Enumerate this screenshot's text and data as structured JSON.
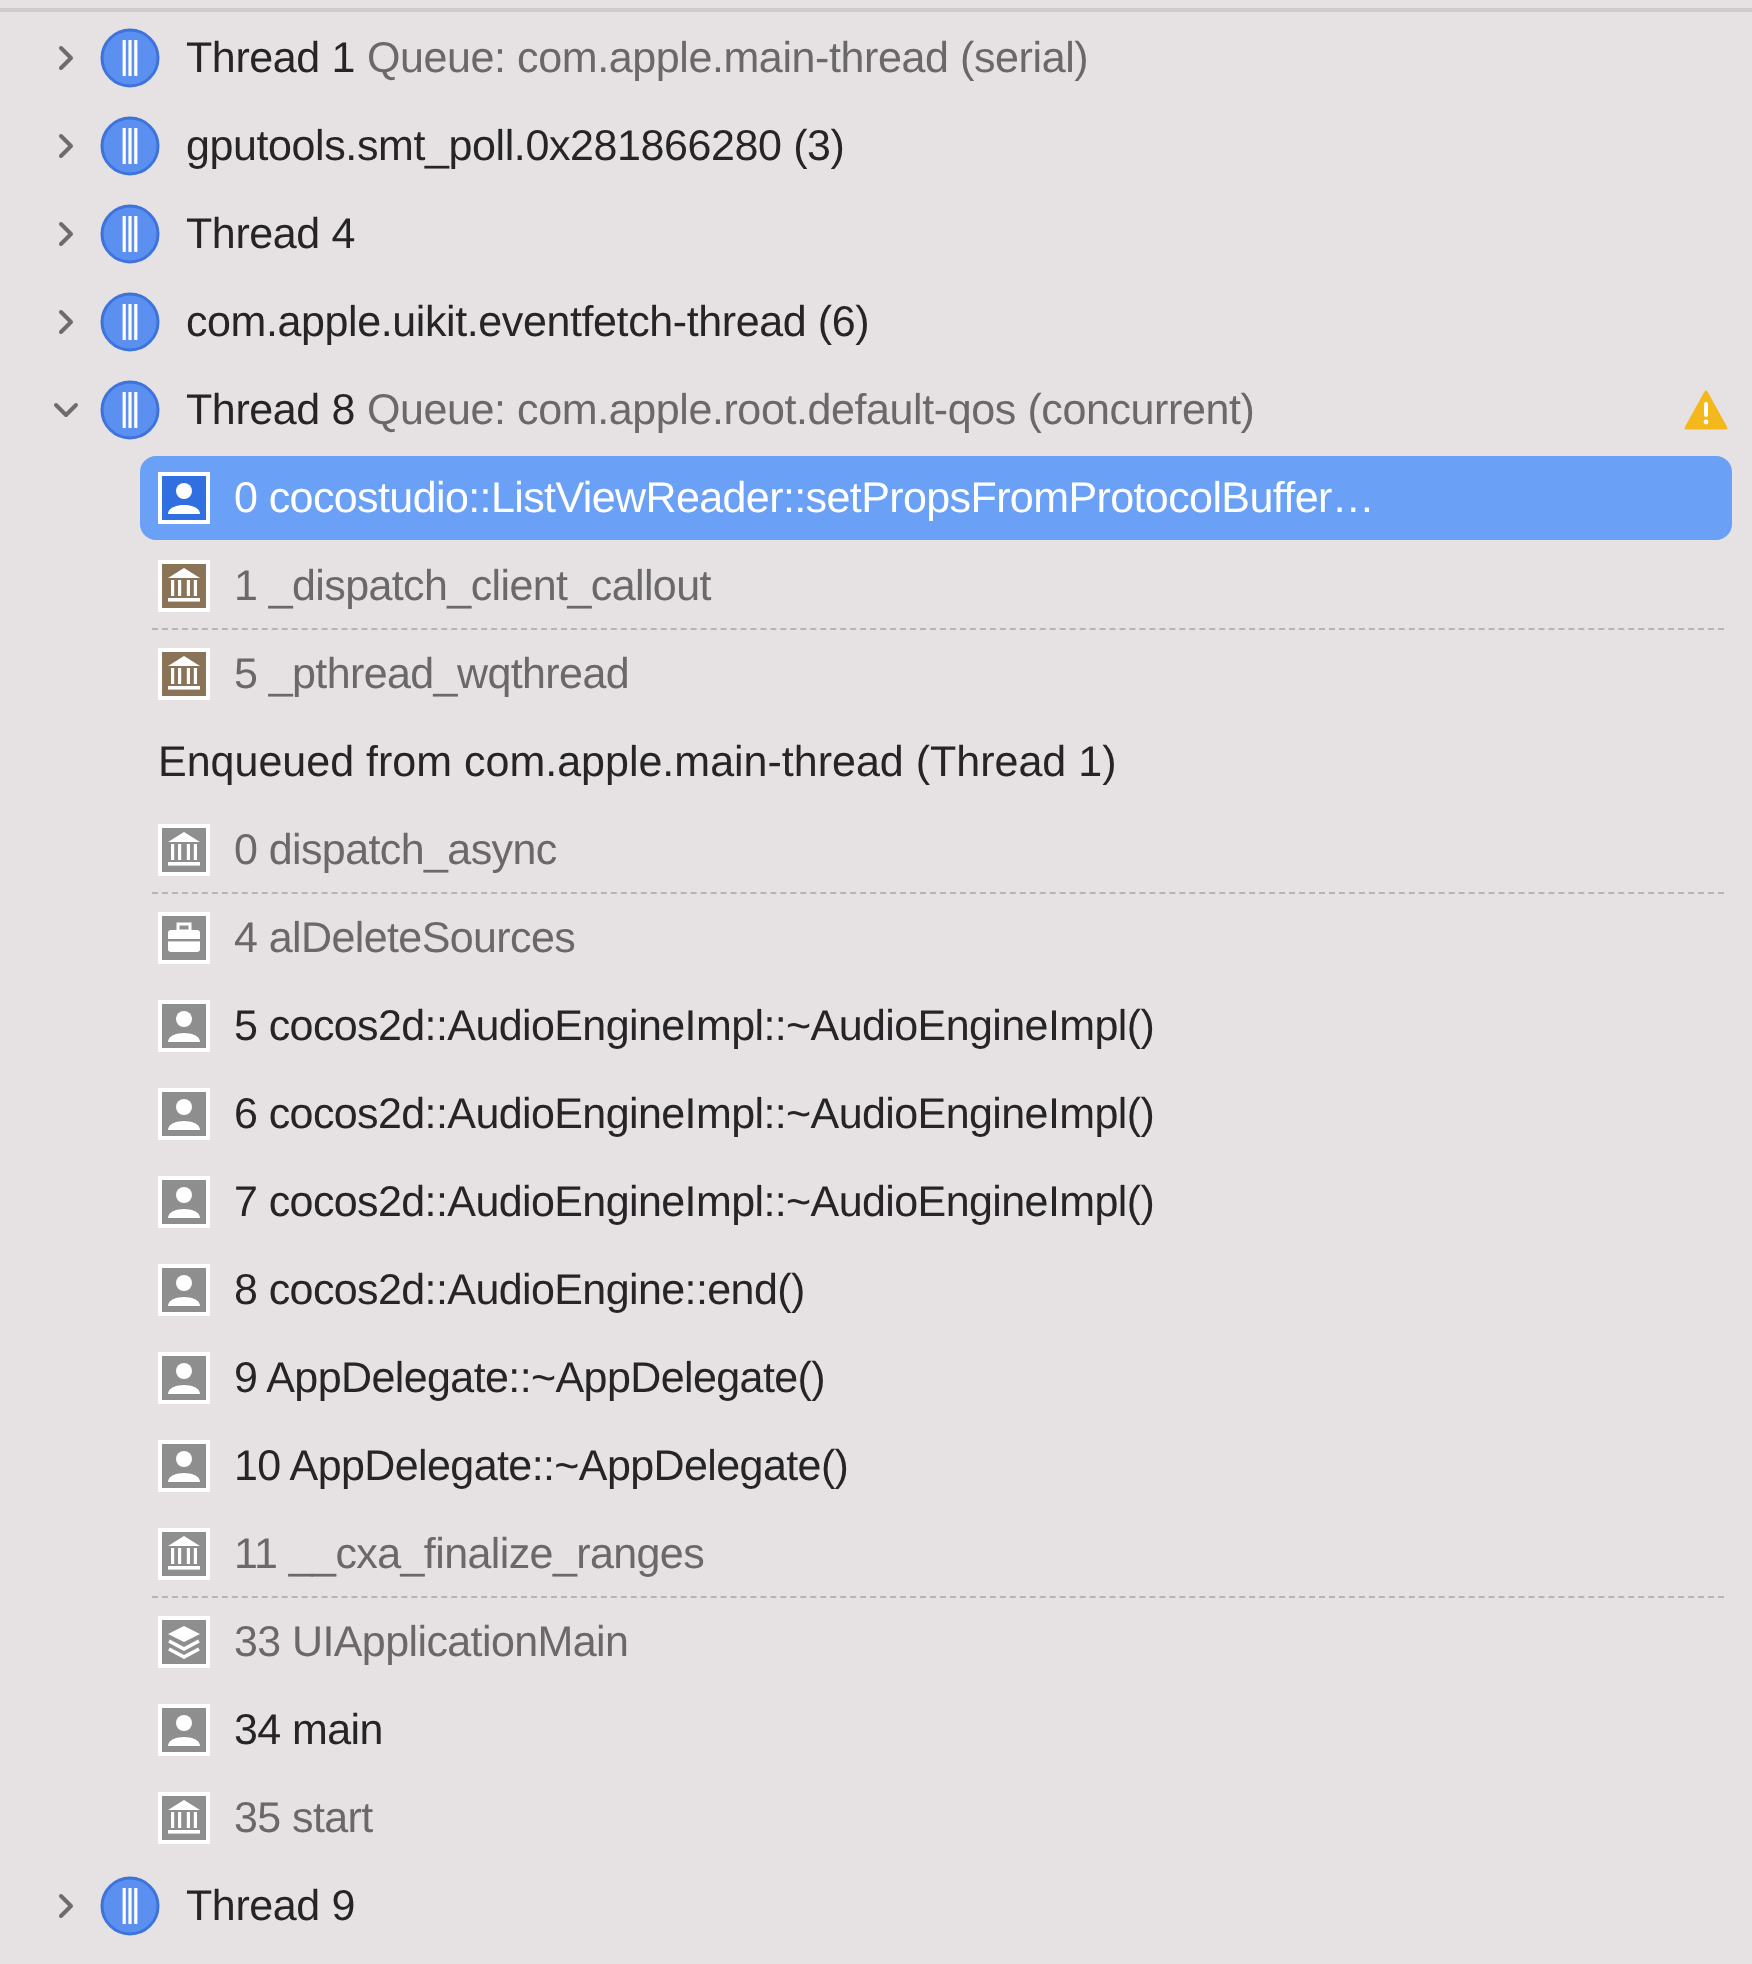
{
  "rows": [
    {
      "kind": "thread",
      "name": "Thread 1",
      "queue": "Queue: com.apple.main-thread (serial)",
      "expanded": false,
      "warning": false
    },
    {
      "kind": "thread",
      "name": "gputools.smt_poll.0x281866280 (3)",
      "expanded": false,
      "warning": false
    },
    {
      "kind": "thread",
      "name": "Thread 4",
      "expanded": false,
      "warning": false
    },
    {
      "kind": "thread",
      "name": "com.apple.uikit.eventfetch-thread (6)",
      "expanded": false,
      "warning": false
    },
    {
      "kind": "thread",
      "name": "Thread 8",
      "queue": "Queue: com.apple.root.default-qos (concurrent)",
      "expanded": true,
      "warning": true
    },
    {
      "kind": "user",
      "color": "#2f6fe0",
      "label": "0 cocostudio::ListViewReader::setPropsFromProtocolBuffer…",
      "dimmed": false,
      "selected": true,
      "separator_after": false
    },
    {
      "kind": "library",
      "color": "#8a7356",
      "label": "1 _dispatch_client_callout",
      "dimmed": true,
      "selected": false,
      "separator_after": true
    },
    {
      "kind": "library",
      "color": "#8a7356",
      "label": "5 _pthread_wqthread",
      "dimmed": true,
      "selected": false,
      "separator_after": false
    },
    {
      "kind": "note",
      "label": "Enqueued from com.apple.main-thread (Thread 1)"
    },
    {
      "kind": "library",
      "color": "#8e8e8e",
      "label": "0 dispatch_async",
      "dimmed": true,
      "selected": false,
      "separator_after": true
    },
    {
      "kind": "toolbox",
      "color": "#8e8e8e",
      "label": "4 alDeleteSources",
      "dimmed": true,
      "selected": false,
      "separator_after": false
    },
    {
      "kind": "user",
      "color": "#8e8e8e",
      "label": "5 cocos2d::AudioEngineImpl::~AudioEngineImpl()",
      "dimmed": false,
      "selected": false,
      "separator_after": false
    },
    {
      "kind": "user",
      "color": "#8e8e8e",
      "label": "6 cocos2d::AudioEngineImpl::~AudioEngineImpl()",
      "dimmed": false,
      "selected": false,
      "separator_after": false
    },
    {
      "kind": "user",
      "color": "#8e8e8e",
      "label": "7 cocos2d::AudioEngineImpl::~AudioEngineImpl()",
      "dimmed": false,
      "selected": false,
      "separator_after": false
    },
    {
      "kind": "user",
      "color": "#8e8e8e",
      "label": "8 cocos2d::AudioEngine::end()",
      "dimmed": false,
      "selected": false,
      "separator_after": false
    },
    {
      "kind": "user",
      "color": "#8e8e8e",
      "label": "9 AppDelegate::~AppDelegate()",
      "dimmed": false,
      "selected": false,
      "separator_after": false
    },
    {
      "kind": "user",
      "color": "#8e8e8e",
      "label": "10 AppDelegate::~AppDelegate()",
      "dimmed": false,
      "selected": false,
      "separator_after": false
    },
    {
      "kind": "library",
      "color": "#8e8e8e",
      "label": "11 __cxa_finalize_ranges",
      "dimmed": true,
      "selected": false,
      "separator_after": true
    },
    {
      "kind": "layers",
      "color": "#8e8e8e",
      "label": "33 UIApplicationMain",
      "dimmed": true,
      "selected": false,
      "separator_after": false
    },
    {
      "kind": "user",
      "color": "#8e8e8e",
      "label": "34 main",
      "dimmed": false,
      "selected": false,
      "separator_after": false
    },
    {
      "kind": "library",
      "color": "#8e8e8e",
      "label": "35 start",
      "dimmed": true,
      "selected": false,
      "separator_after": false
    },
    {
      "kind": "thread",
      "name": "Thread 9",
      "expanded": false,
      "warning": false
    }
  ]
}
